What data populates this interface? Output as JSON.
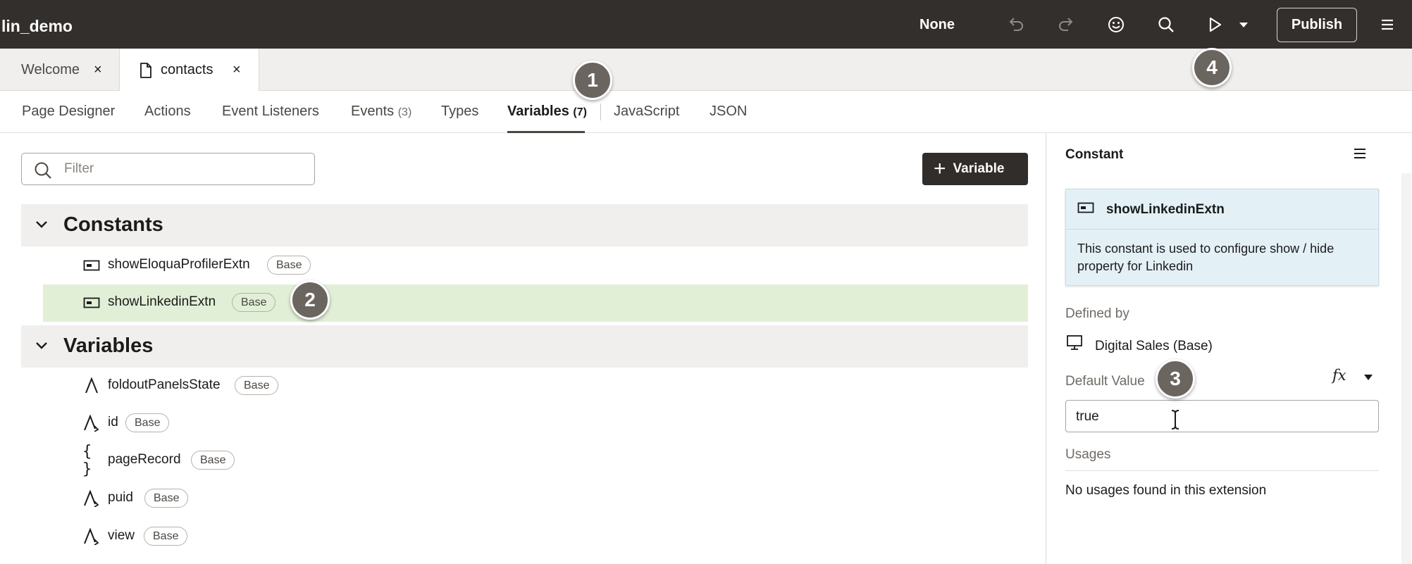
{
  "header": {
    "app_title": "lin_demo",
    "mode_label": "None",
    "publish_label": "Publish",
    "icons": [
      "undo-icon",
      "redo-icon",
      "smiley-icon",
      "search-icon",
      "play-icon",
      "caret-down-icon",
      "hamburger-menu-icon"
    ]
  },
  "doc_tabs": [
    {
      "label": "Welcome",
      "active": false
    },
    {
      "label": "contacts",
      "active": true
    }
  ],
  "sub_tabs": [
    {
      "label": "Page Designer",
      "count": ""
    },
    {
      "label": "Actions",
      "count": ""
    },
    {
      "label": "Event Listeners",
      "count": ""
    },
    {
      "label": "Events",
      "count": "(3)"
    },
    {
      "label": "Types",
      "count": ""
    },
    {
      "label": "Variables",
      "count": "(7)",
      "active": true
    },
    {
      "label": "JavaScript",
      "count": ""
    },
    {
      "label": "JSON",
      "count": ""
    }
  ],
  "filter": {
    "placeholder": "Filter",
    "value": ""
  },
  "add_variable_label": "Variable",
  "sections": {
    "constants": {
      "title": "Constants",
      "items": [
        {
          "name": "showEloquaProfilerExtn",
          "badge": "Base",
          "icon": "constant-icon",
          "selected": false
        },
        {
          "name": "showLinkedinExtn",
          "badge": "Base",
          "icon": "constant-icon",
          "selected": true
        }
      ]
    },
    "variables": {
      "title": "Variables",
      "items": [
        {
          "name": "foldoutPanelsState",
          "badge": "Base",
          "icon": "string-type-icon"
        },
        {
          "name": "id",
          "badge": "Base",
          "icon": "string-key-type-icon"
        },
        {
          "name": "pageRecord",
          "badge": "Base",
          "icon": "object-type-icon"
        },
        {
          "name": "puid",
          "badge": "Base",
          "icon": "string-key-type-icon"
        },
        {
          "name": "view",
          "badge": "Base",
          "icon": "string-key-type-icon"
        }
      ]
    }
  },
  "properties": {
    "panel_title": "Constant",
    "card": {
      "name": "showLinkedinExtn",
      "description": "This constant is used to configure show / hide property for Linkedin"
    },
    "defined_by_label": "Defined by",
    "defined_by_value": "Digital Sales (Base)",
    "default_value_label": "Default Value",
    "fx_label": "fx",
    "default_value": "true",
    "usages_label": "Usages",
    "usages_text": "No usages found in this extension"
  },
  "callouts": [
    "1",
    "2",
    "3",
    "4"
  ]
}
